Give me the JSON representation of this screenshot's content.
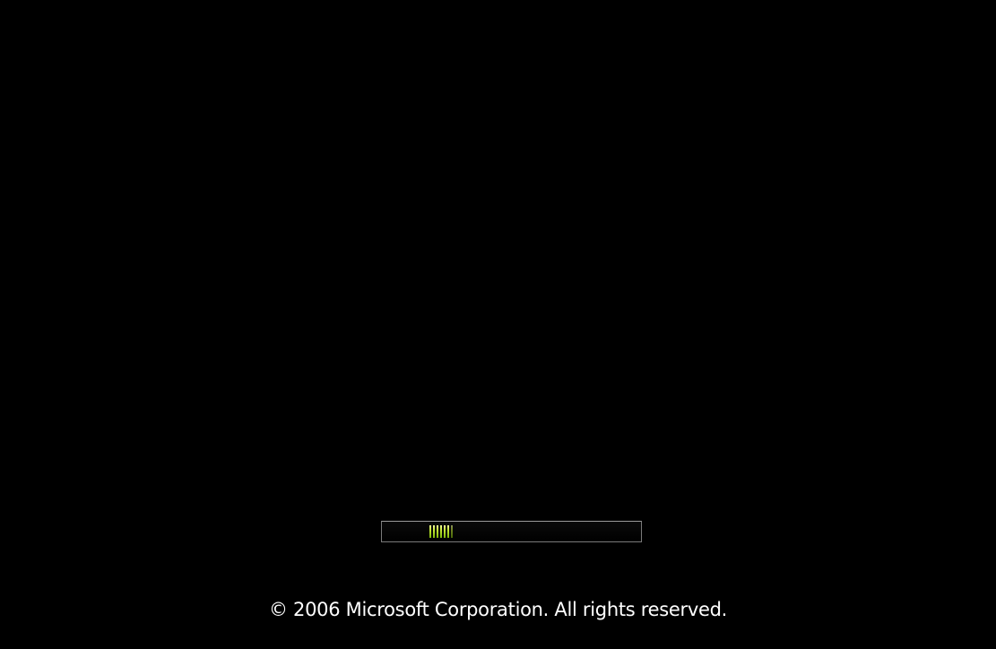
{
  "boot_screen": {
    "copyright_text": "© 2006 Microsoft Corporation. All rights reserved.",
    "progress": {
      "type": "marquee",
      "active_segments": 7,
      "indicator_position_fraction": 0.2,
      "segment_color": "#b8e02c",
      "bar_border_color": "#7a7a7a"
    },
    "background_color": "#000000"
  }
}
